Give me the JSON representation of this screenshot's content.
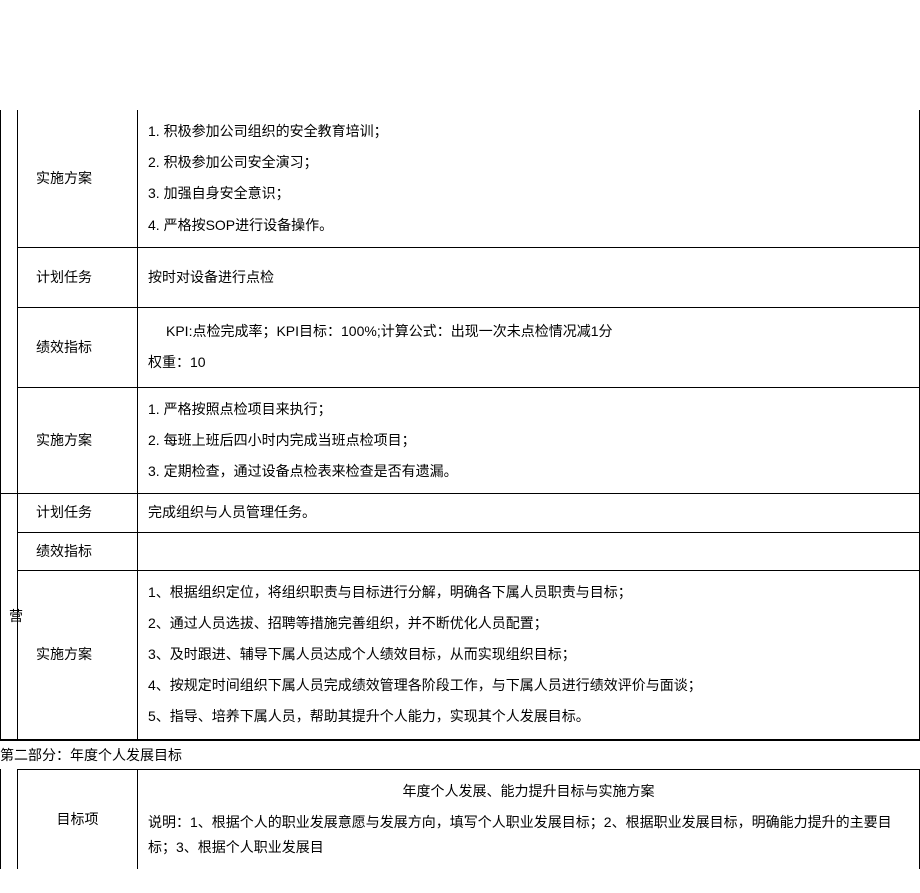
{
  "spacer": "",
  "block1": {
    "label": "实施方案",
    "items": [
      "1.    积极参加公司组织的安全教育培训；",
      "2.    积极参加公司安全演习；",
      "3.    加强自身安全意识；",
      "4.    严格按SOP进行设备操作。"
    ]
  },
  "block2": {
    "row1_label": "计划任务",
    "row1_content": "按时对设备进行点检",
    "row2_label": "绩效指标",
    "row2_line1": "KPI:点检完成率；KPI目标：100%;计算公式：出现一次未点检情况减1分",
    "row2_line2": "权重：10",
    "row3_label": "实施方案",
    "row3_items": [
      "1. 严格按照点检项目来执行；",
      "2. 每班上班后四小时内完成当班点检项目；",
      "3. 定期检查，通过设备点检表来检查是否有遗漏。"
    ]
  },
  "block3": {
    "side_char": "营",
    "row1_label": "计划任务",
    "row1_content": "完成组织与人员管理任务。",
    "row2_label": "绩效指标",
    "row2_content": "",
    "row3_label": "实施方案",
    "row3_items": [
      "1、根据组织定位，将组织职责与目标进行分解，明确各下属人员职责与目标；",
      "2、通过人员选拔、招聘等措施完善组织，并不断优化人员配置；",
      "3、及时跟进、辅导下属人员达成个人绩效目标，从而实现组织目标；",
      "4、按规定时间组织下属人员完成绩效管理各阶段工作，与下属人员进行绩效评价与面谈；",
      "5、指导、培养下属人员，帮助其提升个人能力，实现其个人发展目标。"
    ]
  },
  "section2": {
    "header": "第二部分：年度个人发展目标",
    "target_label": "目标项",
    "title": "年度个人发展、能力提升目标与实施方案",
    "desc": "说明：1、根据个人的职业发展意愿与发展方向，填写个人职业发展目标；2、根据职业发展目标，明确能力提升的主要目标；3、根据个人职业发展目"
  }
}
